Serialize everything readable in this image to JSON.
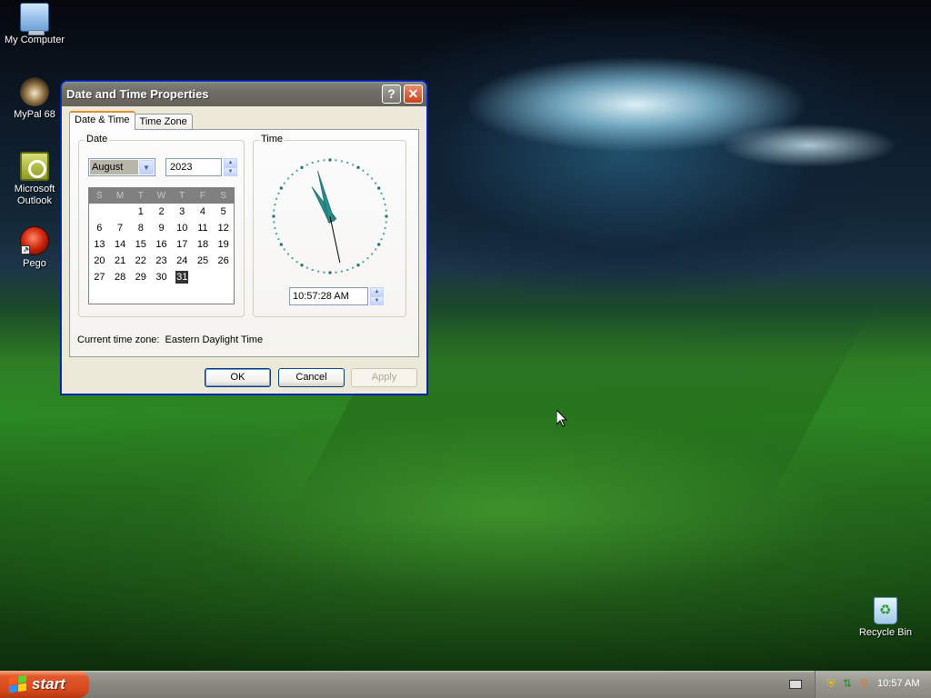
{
  "desktop": {
    "icons": [
      {
        "label": "My Computer",
        "icon": "my-computer-icon"
      },
      {
        "label": "MyPal 68",
        "icon": "mypal-browser-icon"
      },
      {
        "label": "Microsoft Outlook",
        "icon": "outlook-icon"
      },
      {
        "label": "Pego",
        "icon": "pego-icon"
      },
      {
        "label": "Recycle Bin",
        "icon": "recycle-bin-icon"
      }
    ]
  },
  "dialog": {
    "title": "Date and Time Properties",
    "help_button": "?",
    "close_button": "✕",
    "tabs": [
      {
        "label": "Date & Time",
        "active": true
      },
      {
        "label": "Time Zone",
        "active": false
      }
    ],
    "date_group_label": "Date",
    "time_group_label": "Time",
    "month_value": "August",
    "year_value": "2023",
    "calendar": {
      "weekday_headers": [
        "S",
        "M",
        "T",
        "W",
        "T",
        "F",
        "S"
      ],
      "weeks": [
        [
          "",
          "",
          "1",
          "2",
          "3",
          "4",
          "5"
        ],
        [
          "6",
          "7",
          "8",
          "9",
          "10",
          "11",
          "12"
        ],
        [
          "13",
          "14",
          "15",
          "16",
          "17",
          "18",
          "19"
        ],
        [
          "20",
          "21",
          "22",
          "23",
          "24",
          "25",
          "26"
        ],
        [
          "27",
          "28",
          "29",
          "30",
          "31",
          "",
          ""
        ]
      ],
      "selected_day": "31"
    },
    "clock": {
      "hour": 10,
      "minute": 57,
      "second": 28,
      "hand_color": "#2a8b8b"
    },
    "time_value": "10:57:28 AM",
    "timezone_label": "Current time zone:",
    "timezone_value": "Eastern Daylight Time",
    "buttons": {
      "ok": "OK",
      "cancel": "Cancel",
      "apply": "Apply"
    }
  },
  "taskbar": {
    "start_label": "start",
    "clock": "10:57 AM",
    "tray_icons": [
      "security-shield-icon",
      "network-icon",
      "search-icon"
    ]
  },
  "colors": {
    "titlebar": "#6e6d66",
    "start_button": "#d54a1e",
    "active_tab_accent": "#e68b2c",
    "selected_day_bg": "#333333"
  }
}
